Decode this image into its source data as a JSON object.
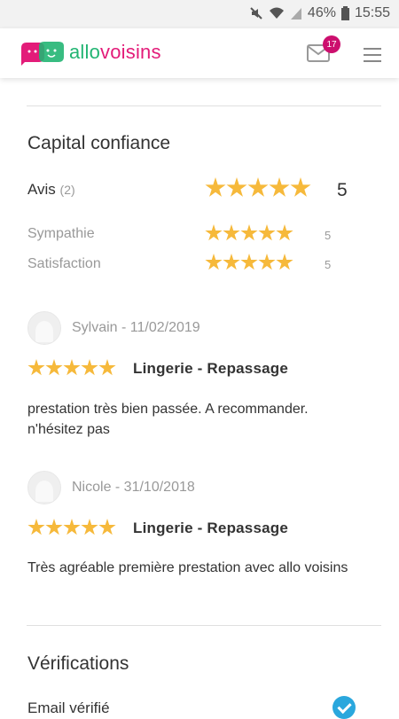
{
  "status_bar": {
    "battery": "46%",
    "time": "15:55"
  },
  "header": {
    "logo_part1": "allo",
    "logo_part2": "voisins",
    "mail_badge": "17"
  },
  "capital": {
    "title": "Capital confiance",
    "avis_label": "Avis",
    "avis_count": "(2)",
    "avis_rating": 5,
    "avis_score": "5",
    "metrics": [
      {
        "label": "Sympathie",
        "rating": 5,
        "score": "5"
      },
      {
        "label": "Satisfaction",
        "rating": 5,
        "score": "5"
      }
    ]
  },
  "reviews": [
    {
      "author": "Sylvain - 11/02/2019",
      "rating": 5,
      "category": "Lingerie - Repassage",
      "comment": "prestation très bien passée. A recommander. n'hésitez pas"
    },
    {
      "author": "Nicole - 31/10/2018",
      "rating": 5,
      "category": "Lingerie - Repassage",
      "comment": "Très agréable première prestation avec allo voisins"
    }
  ],
  "verifications": {
    "title": "Vérifications",
    "items": [
      {
        "label": "Email vérifié"
      }
    ]
  },
  "colors": {
    "star": "#f6b93b",
    "badge": "#cc0f6e",
    "logo_green": "#22b573",
    "logo_pink": "#e31c79",
    "check": "#2aa7dd"
  }
}
